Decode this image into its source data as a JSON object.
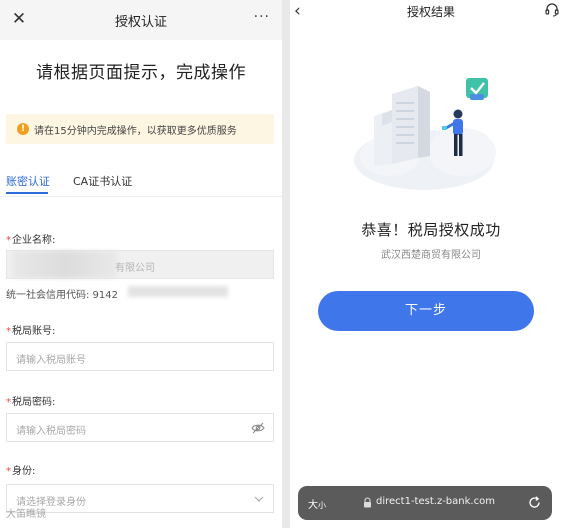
{
  "left": {
    "nav": {
      "close": "✕",
      "title": "授权认证",
      "more": "···"
    },
    "heading": "请根据页面提示，完成操作",
    "notice": {
      "icon": "!",
      "text": "请在15分钟内完成操作，以获取更多优质服务"
    },
    "tabs": [
      {
        "label": "账密认证",
        "active": true
      },
      {
        "label": "CA证书认证",
        "active": false
      }
    ],
    "fields": {
      "company": {
        "required_mark": "*",
        "label": "企业名称:",
        "value_suffix": "有限公司"
      },
      "credit_code": {
        "label": "统一社会信用代码: 9142"
      },
      "tax_account": {
        "required_mark": "*",
        "label": "税局账号:",
        "placeholder": "请输入税局账号"
      },
      "tax_password": {
        "required_mark": "*",
        "label": "税局密码:",
        "placeholder": "请输入税局密码",
        "icon": "eye-off-icon"
      },
      "identity": {
        "required_mark": "*",
        "label": "身份:",
        "placeholder": "请选择登录身份",
        "icon": "chevron-down-icon"
      }
    },
    "watermark": "大笛瞧镜"
  },
  "right": {
    "nav": {
      "back": "‹",
      "title": "授权结果",
      "support_icon": "headset-icon"
    },
    "illustration": "success-illustration",
    "success_title": "恭喜！税局授权成功",
    "company_name": "武汉西楚商贸有限公司",
    "next_button": "下一步",
    "browser_bar": {
      "text_size_big": "大",
      "text_size_small": "小",
      "url": "direct1-test.z-bank.com",
      "lock_icon": "lock-icon",
      "reload_icon": "reload-icon"
    }
  },
  "colors": {
    "accent": "#3f76ea",
    "tab_active": "#2d6bd8",
    "required": "#e74c3c",
    "notice_bg": "#fdf6e3",
    "notice_icon": "#f0a020",
    "check_green": "#3fc2a6"
  }
}
